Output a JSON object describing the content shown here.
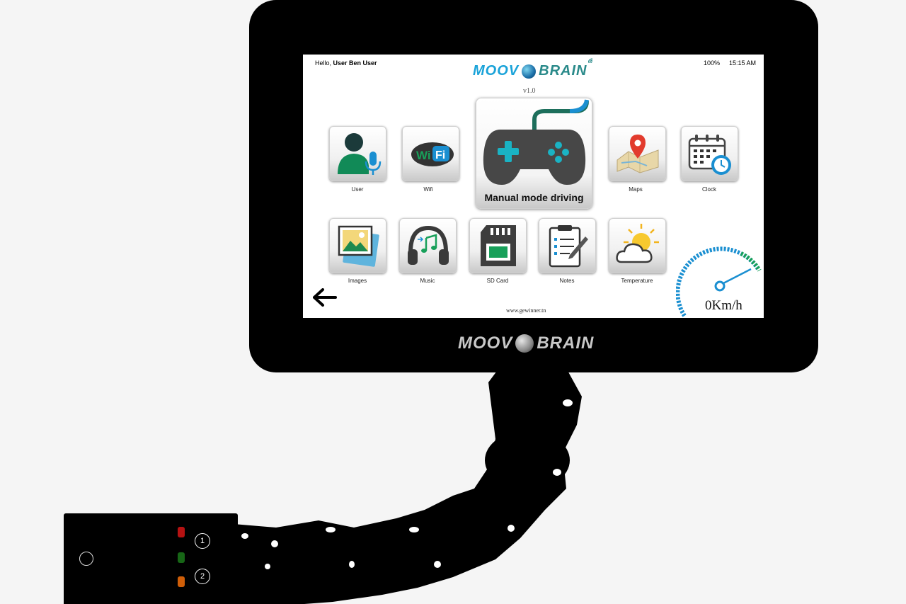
{
  "status_bar": {
    "greeting_prefix": "Hello,",
    "user_name": "User Ben User",
    "battery": "100%",
    "time": "15:15 AM"
  },
  "brand": {
    "word1": "MOOV",
    "word2": "BRAIN",
    "version": "v1.0",
    "primary_color": "#1aa3d9",
    "secondary_color": "#2a8a8a"
  },
  "tiles": {
    "user": {
      "label": "User",
      "icon": "user-microphone-icon"
    },
    "wifi": {
      "label": "Wifi",
      "icon": "wifi-icon"
    },
    "manual": {
      "label": "Manual mode driving",
      "icon": "gamepad-icon"
    },
    "maps": {
      "label": "Maps",
      "icon": "map-pin-icon"
    },
    "clock": {
      "label": "Clock",
      "icon": "calendar-clock-icon"
    },
    "images": {
      "label": "Images",
      "icon": "photos-icon"
    },
    "music": {
      "label": "Music",
      "icon": "headphones-icon"
    },
    "sdcard": {
      "label": "SD Card",
      "icon": "sd-card-icon"
    },
    "notes": {
      "label": "Notes",
      "icon": "clipboard-notes-icon"
    },
    "temperature": {
      "label": "Temperature",
      "icon": "weather-icon"
    }
  },
  "footer": {
    "website": "www.gewinner.tn",
    "speed": "0Km/h"
  },
  "device": {
    "button_1": "1",
    "button_2": "2"
  }
}
